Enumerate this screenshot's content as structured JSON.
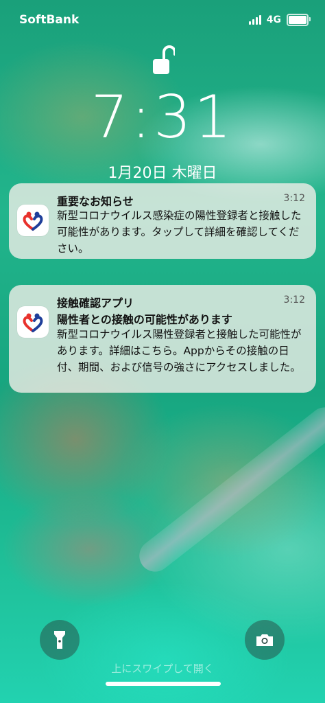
{
  "status_bar": {
    "carrier": "SoftBank",
    "network": "4G",
    "battery_level": 1.0
  },
  "lock_screen": {
    "time": "7:31",
    "date": "1月20日 木曜日",
    "swipe_hint": "上にスワイプして開く"
  },
  "notifications": [
    {
      "title": "重要なお知らせ",
      "time": "3:12",
      "body": "新型コロナウイルス感染症の陽性登録者と接触した可能性があります。タップして詳細を確認してください。",
      "icon": "cocoa-app-icon"
    },
    {
      "title": "接触確認アプリ",
      "subtitle": "陽性者との接触の可能性があります",
      "time": "3:12",
      "body": "新型コロナウイルス陽性登録者と接触した可能性があります。詳細はこちら。Appからその接触の日付、期間、および信号の強さにアクセスしました。",
      "icon": "cocoa-app-icon"
    }
  ],
  "controls": {
    "left": "flashlight-icon",
    "right": "camera-icon"
  },
  "colors": {
    "icon_red": "#e8322d",
    "icon_blue": "#1f3f9a",
    "wallpaper_base": "#1aa07a"
  }
}
